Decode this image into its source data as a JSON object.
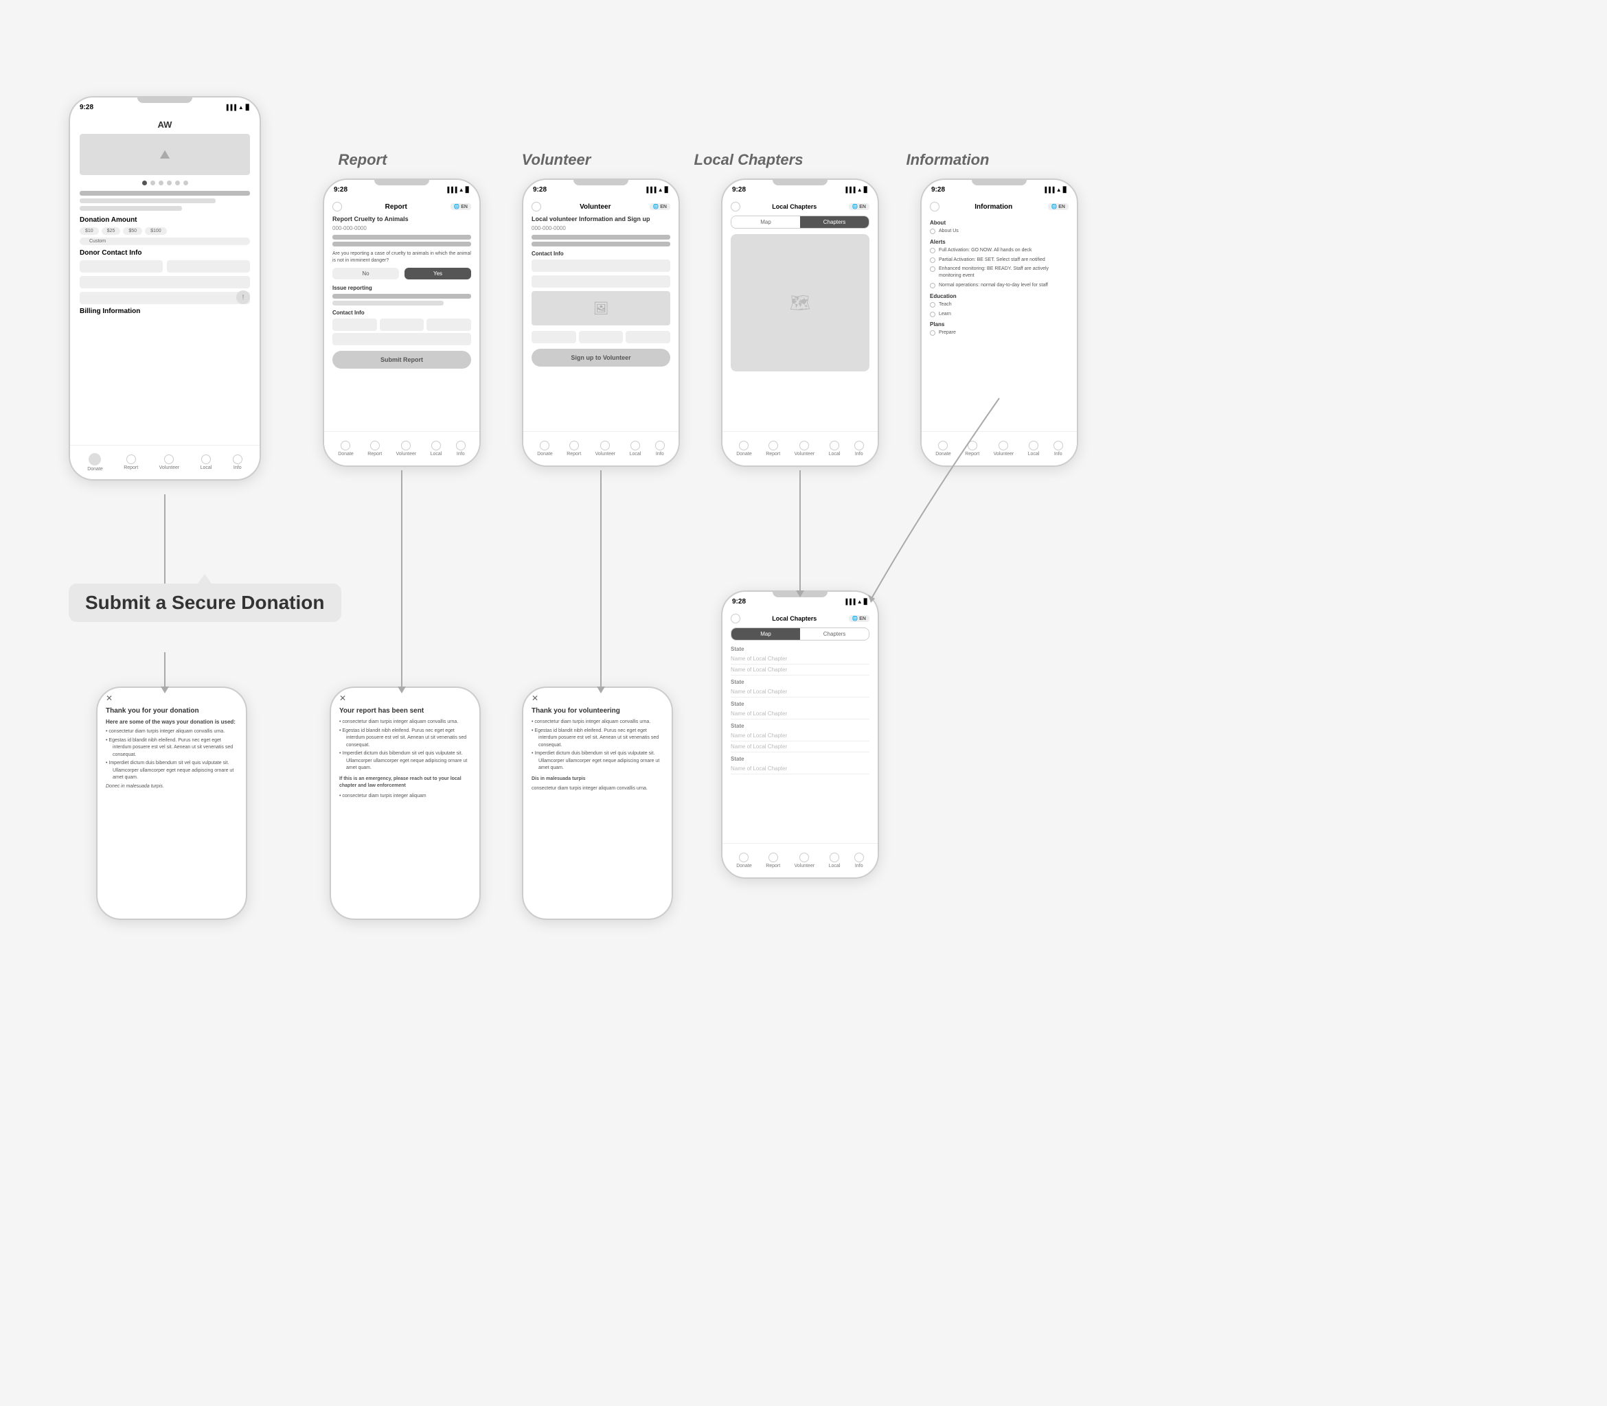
{
  "screens": {
    "main": {
      "label": "Donate",
      "time": "9:28",
      "header": "AW",
      "sections": {
        "donation_amount": "Donation Amount",
        "donor_contact": "Donor Contact Info",
        "billing": "Billing Information"
      },
      "amount_options": [
        "$10",
        "$25",
        "$50",
        "$100"
      ],
      "amount_custom": "Custom",
      "nav": [
        "Donate",
        "Report",
        "Volunteer",
        "Local",
        "Info"
      ]
    },
    "report": {
      "label": "Report",
      "title": "Report",
      "en": "EN",
      "form_title": "Report Cruelty to Animals",
      "phone": "000-000-0000",
      "question": "Are you reporting a case of cruelty to animals in which the animal is not in imminent danger?",
      "no_btn": "No",
      "yes_btn": "Yes",
      "issue_label": "Issue reporting",
      "contact_label": "Contact Info",
      "submit_btn": "Submit Report"
    },
    "volunteer": {
      "label": "Volunteer",
      "title": "Volunteer",
      "en": "EN",
      "form_title": "Local volunteer Information and Sign up",
      "phone": "000-000-0000",
      "contact_label": "Contact Info",
      "sign_up_btn": "Sign up to Volunteer"
    },
    "local_top": {
      "label": "Local Chapters",
      "title": "Local Chapters",
      "en": "EN",
      "tab_map": "Map",
      "tab_chapters": "Chapters",
      "active_tab": "Chapters"
    },
    "local_bottom": {
      "title": "Local Chapters",
      "en": "EN",
      "tab_map": "Map",
      "tab_chapters": "Chapters",
      "active_tab": "Map",
      "states": [
        "State",
        "State",
        "State",
        "State",
        "State"
      ],
      "chapters": [
        [
          "Name of Local Chapter",
          "Name of Local Chapter"
        ],
        [
          "Name of Local Chapter"
        ],
        [
          "Name of Local Chapter"
        ],
        [
          "Name of Local Chapter",
          "Name of Local Chapter"
        ],
        [
          "Name of Local Chapter"
        ]
      ]
    },
    "info": {
      "label": "Information",
      "title": "Information",
      "en": "EN",
      "about_section": "About",
      "about_items": [
        "About Us"
      ],
      "alerts_section": "Alerts",
      "alerts_items": [
        "Full Activation: GO NOW. All hands on deck",
        "Partial Activation: BE SET. Select staff are notified",
        "Enhanced monitoring: BE READY. Staff are actively monitoring event",
        "Normal operations: normal day-to-day level for staff"
      ],
      "education_section": "Education",
      "education_items": [
        "Teach",
        "Learn"
      ],
      "plans_section": "Plans",
      "plans_items": [
        "Prepare"
      ]
    }
  },
  "modals": {
    "donate": {
      "close": "✕",
      "title": "Thank you for your donation",
      "subtitle": "Here are some of the ways your donation is used:",
      "bullets": [
        "consectetur diam turpis integer aliquam convallis urna.",
        "Egestas id blandit nibh eleifend. Purus nec eget eget interdum posuere est vel sit. Aenean ut sit venenatis sed consequat.",
        "Imperdiet dictum duis bibendum sit vel quis vulputate sit. Ullamcorper ullamcorper eget neque adipiscing ornare ut amet quam."
      ],
      "footer": "Donec in malesuada turpis."
    },
    "report": {
      "close": "✕",
      "title": "Your report has been sent",
      "bullets": [
        "consectetur diam turpis integer aliquam convallis urna.",
        "Egestas id blandit nibh eleifend. Purus nec eget eget interdum posuere est vel sit. Aenean ut sit venenatis sed consequat.",
        "Imperdiet dictum duis bibendum sit vel quis vulputate sit. Ullamcorper ullamcorper eget neque adipiscing ornare ut amet quam."
      ],
      "emergency": "If this is an emergency, please reach out to your local chapter and law enforcement",
      "emergency_bullets": [
        "consectetur diam turpis integer aliquam"
      ]
    },
    "volunteer": {
      "close": "✕",
      "title": "Thank you for volunteering",
      "bullets": [
        "consectetur diam turpis integer aliquam convallis urna.",
        "Egestas id blandit nibh eleifend. Purus nec eget eget interdum posuere est vel sit. Aenean ut sit venenatis sed consequat.",
        "Imperdiet dictum duis bibendum sit vel quis vulputate sit. Ullamcorper ullamcorper eget neque adipiscing ornare ut amet quam."
      ],
      "footer_title": "Dis in malesuada turpis",
      "footer_text": "consectetur diam turpis integer aliquam convallis urna."
    }
  },
  "callout": {
    "text": "Submit a Secure Donation"
  },
  "connectors": {}
}
